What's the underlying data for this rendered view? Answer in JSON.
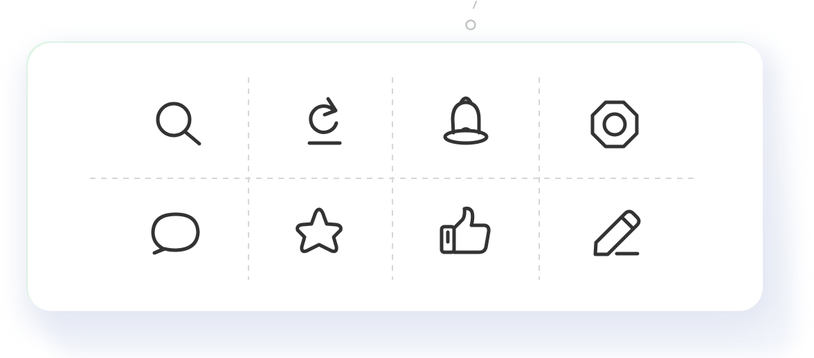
{
  "theme": {
    "icon_color": "#333333",
    "divider_color": "#d6d6d6",
    "card_background": "#ffffff",
    "page_background": "#ffffff"
  },
  "icon_grid": {
    "rows": [
      [
        "search-icon",
        "refresh-icon",
        "bell-icon",
        "octagon-settings-icon"
      ],
      [
        "chat-bubble-icon",
        "star-icon",
        "thumbs-up-icon",
        "pencil-edit-icon"
      ]
    ]
  }
}
